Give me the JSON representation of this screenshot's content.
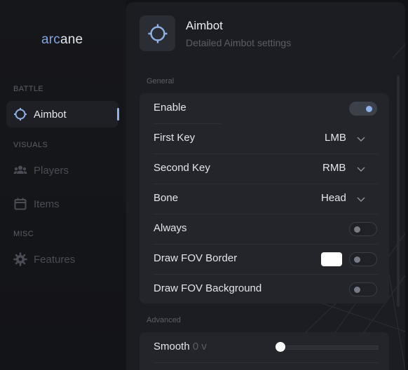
{
  "app": {
    "logo_prefix": "arc",
    "logo_suffix": "ane"
  },
  "sidebar": {
    "sections": [
      {
        "label": "BATTLE"
      },
      {
        "label": "VISUALS"
      },
      {
        "label": "MISC"
      }
    ],
    "items": [
      {
        "label": "Aimbot",
        "icon": "crosshair-icon",
        "active": true
      },
      {
        "label": "Players",
        "icon": "users-icon",
        "active": false
      },
      {
        "label": "Items",
        "icon": "calendar-icon",
        "active": false
      },
      {
        "label": "Features",
        "icon": "gear-icon",
        "active": false
      }
    ]
  },
  "header": {
    "title": "Aimbot",
    "subtitle": "Detailed Aimbot settings",
    "icon": "crosshair-icon"
  },
  "general": {
    "label": "General",
    "enable": {
      "label": "Enable",
      "checked": true
    },
    "first_key": {
      "label": "First Key",
      "value": "LMB"
    },
    "second_key": {
      "label": "Second Key",
      "value": "RMB"
    },
    "bone": {
      "label": "Bone",
      "value": "Head"
    },
    "always": {
      "label": "Always",
      "checked": false
    },
    "draw_fov_border": {
      "label": "Draw FOV Border",
      "checked": false,
      "color": "#ffffff"
    },
    "draw_fov_background": {
      "label": "Draw FOV Background",
      "checked": false
    }
  },
  "advanced": {
    "label": "Advanced",
    "smooth": {
      "label": "Smooth",
      "value_text": "0 v",
      "value": 0
    }
  },
  "colors": {
    "accent": "#8fb2e6",
    "panel": "#1c1d22",
    "card": "#23252b"
  }
}
